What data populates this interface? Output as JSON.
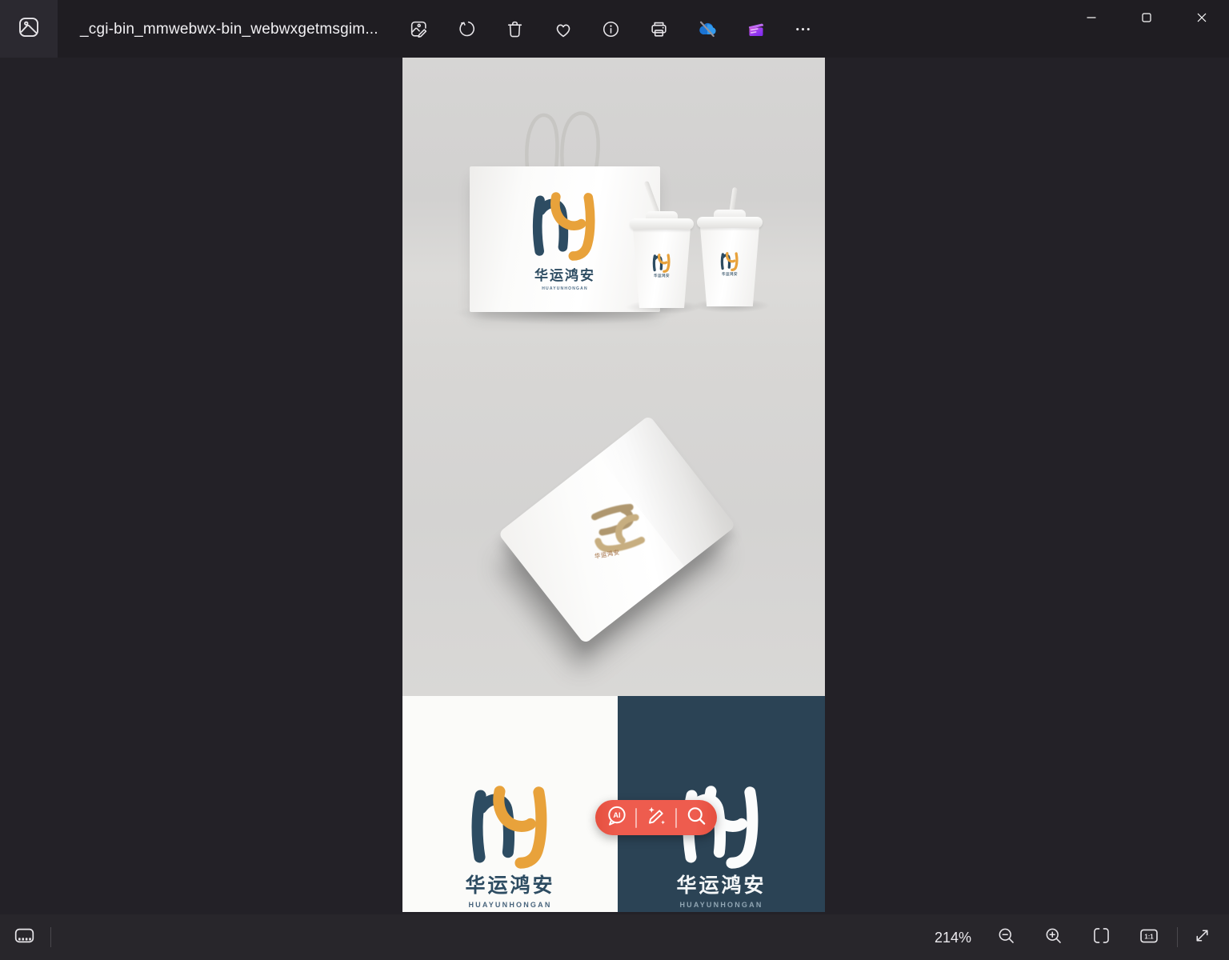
{
  "window": {
    "title": "_cgi-bin_mmwebwx-bin_webwxgetmsgim...",
    "app_icon": "photos-gallery-icon",
    "controls": [
      "minimize",
      "maximize",
      "close"
    ]
  },
  "toolbar": {
    "buttons": [
      "edit-image",
      "rotate",
      "delete",
      "favorite",
      "info",
      "print",
      "onedrive-sync-unavailable",
      "clipchamp",
      "see-more"
    ]
  },
  "statusbar": {
    "zoom_level": "214%",
    "buttons_left": [
      "filmstrip-toggle"
    ],
    "buttons_right": [
      "zoom-out",
      "zoom-in",
      "fit-to-window",
      "actual-size",
      "fullscreen"
    ],
    "actual_size_label": "1:1"
  },
  "photo": {
    "brand_cn": "华运鸿安",
    "brand_en": "HUAYUNHONGAN",
    "ai_label": "AI",
    "overlay_buttons": [
      "ai-chat",
      "magic-edit",
      "visual-search"
    ],
    "colors": {
      "logo_navy": "#2d4c62",
      "logo_orange": "#e8a23b",
      "logo_gold": "#b4996c",
      "panel_navy": "#2b4355",
      "pill_red": "#ee5c4e"
    }
  }
}
